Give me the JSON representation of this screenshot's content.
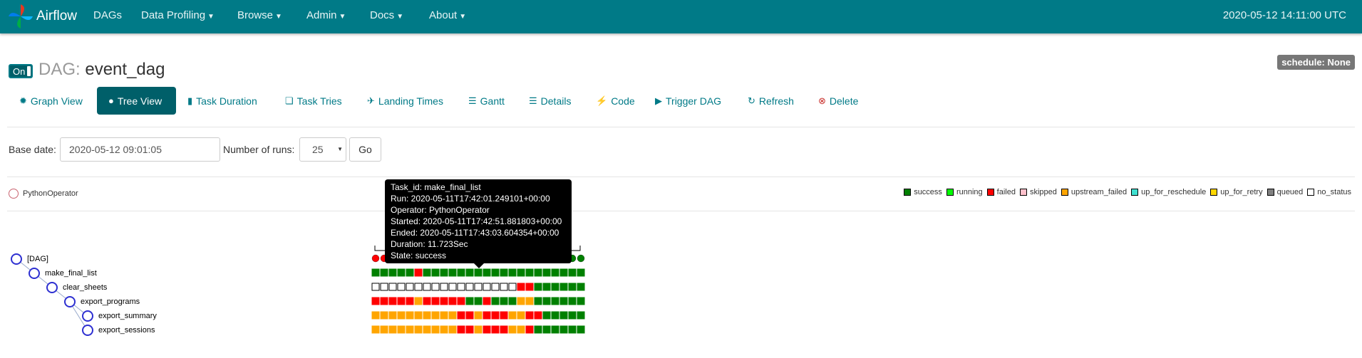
{
  "nav": {
    "brand": "Airflow",
    "items": [
      {
        "label": "DAGs",
        "dropdown": false
      },
      {
        "label": "Data Profiling",
        "dropdown": true
      },
      {
        "label": "Browse",
        "dropdown": true
      },
      {
        "label": "Admin",
        "dropdown": true
      },
      {
        "label": "Docs",
        "dropdown": true
      },
      {
        "label": "About",
        "dropdown": true
      }
    ],
    "time": "2020-05-12 14:11:00 UTC"
  },
  "dag": {
    "toggle": "On",
    "prefix": "DAG:",
    "name": "event_dag",
    "schedule": "schedule: None"
  },
  "tabs": [
    {
      "label": "Graph View",
      "icon": "asterisk-icon",
      "active": false
    },
    {
      "label": "Tree View",
      "icon": "tree-icon",
      "active": true
    },
    {
      "label": "Task Duration",
      "icon": "bar-chart-icon",
      "active": false
    },
    {
      "label": "Task Tries",
      "icon": "duplicate-icon",
      "active": false
    },
    {
      "label": "Landing Times",
      "icon": "plane-icon",
      "active": false
    },
    {
      "label": "Gantt",
      "icon": "gantt-icon",
      "active": false
    },
    {
      "label": "Details",
      "icon": "list-icon",
      "active": false
    },
    {
      "label": "Code",
      "icon": "flash-icon",
      "active": false
    },
    {
      "label": "Trigger DAG",
      "icon": "play-circle-icon",
      "active": false
    },
    {
      "label": "Refresh",
      "icon": "refresh-icon",
      "active": false
    },
    {
      "label": "Delete",
      "icon": "remove-circle-icon",
      "active": false
    }
  ],
  "form": {
    "base_date_label": "Base date:",
    "base_date_value": "2020-05-12 09:01:05",
    "num_runs_label": "Number of runs:",
    "num_runs_value": "25",
    "go_label": "Go"
  },
  "operator_legend": "PythonOperator",
  "state_legend": [
    {
      "label": "success",
      "color": "#008000"
    },
    {
      "label": "running",
      "color": "#00ff00"
    },
    {
      "label": "failed",
      "color": "#ff0000"
    },
    {
      "label": "skipped",
      "color": "#ffc0cb"
    },
    {
      "label": "upstream_failed",
      "color": "#ffa500"
    },
    {
      "label": "up_for_reschedule",
      "color": "#40e0d0"
    },
    {
      "label": "up_for_retry",
      "color": "#ffd700"
    },
    {
      "label": "queued",
      "color": "#808080"
    },
    {
      "label": "no_status",
      "color": "#ffffff"
    }
  ],
  "tree": [
    {
      "label": "[DAG]",
      "depth": 0
    },
    {
      "label": "make_final_list",
      "depth": 1
    },
    {
      "label": "clear_sheets",
      "depth": 2
    },
    {
      "label": "export_programs",
      "depth": 3
    },
    {
      "label": "export_summary",
      "depth": 4
    },
    {
      "label": "export_sessions",
      "depth": 4
    }
  ],
  "grid": {
    "dag_runs": "FFSSSSSSSSSSSSSSSSSSSSSSS",
    "rows": [
      "SSSSSFSSSSSSSSSSSSSSSSSSS",
      "NNNNNNNNNNNNNNNNNFFSSSSSS",
      "FFFFFUFFFFFSSFSSSUUSSSSSS",
      "UUUUUUUUUUFFUFFFUUFFSSSSS",
      "UUUUUUUUUUFFUFFFUUFSSSSSS"
    ],
    "codes": {
      "S": "#008000",
      "F": "#ff0000",
      "U": "#ffa500",
      "N": "#ffffff"
    }
  },
  "tooltip": [
    "Task_id: make_final_list",
    "Run: 2020-05-11T17:42:01.249101+00:00",
    "Operator: PythonOperator",
    "Started: 2020-05-11T17:42:51.881803+00:00",
    "Ended: 2020-05-11T17:43:03.604354+00:00",
    "Duration: 11.723Sec",
    "State: success"
  ]
}
